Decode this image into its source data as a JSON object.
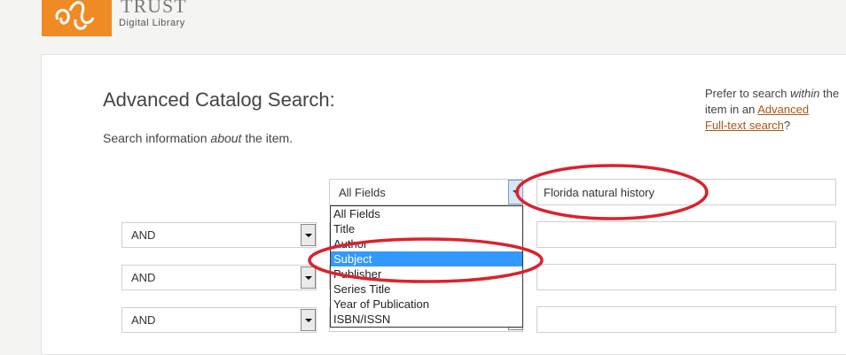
{
  "header": {
    "logo_title": "TRUST",
    "logo_subtitle": "Digital Library",
    "brand_color": "#f08a24"
  },
  "search": {
    "title": "Advanced Catalog Search:",
    "about_prefix": "Search information ",
    "about_emph": "about",
    "about_suffix": " the item."
  },
  "prefer": {
    "line1_prefix": "Prefer to search ",
    "line1_emph": "within",
    "line1_suffix": " the",
    "line2_prefix": "item in an ",
    "link1": "Advanced",
    "link2": "Full-text search",
    "line3_suffix": "?"
  },
  "rows": [
    {
      "field": "All Fields",
      "term": "Florida natural history"
    },
    {
      "boolean": "AND",
      "term": ""
    },
    {
      "boolean": "AND",
      "term": ""
    },
    {
      "boolean": "AND",
      "term": ""
    }
  ],
  "field_options": [
    "All Fields",
    "Title",
    "Author",
    "Subject",
    "Publisher",
    "Series Title",
    "Year of Publication",
    "ISBN/ISSN"
  ],
  "highlighted_option": "Subject",
  "annotation_color": "#d9232d"
}
